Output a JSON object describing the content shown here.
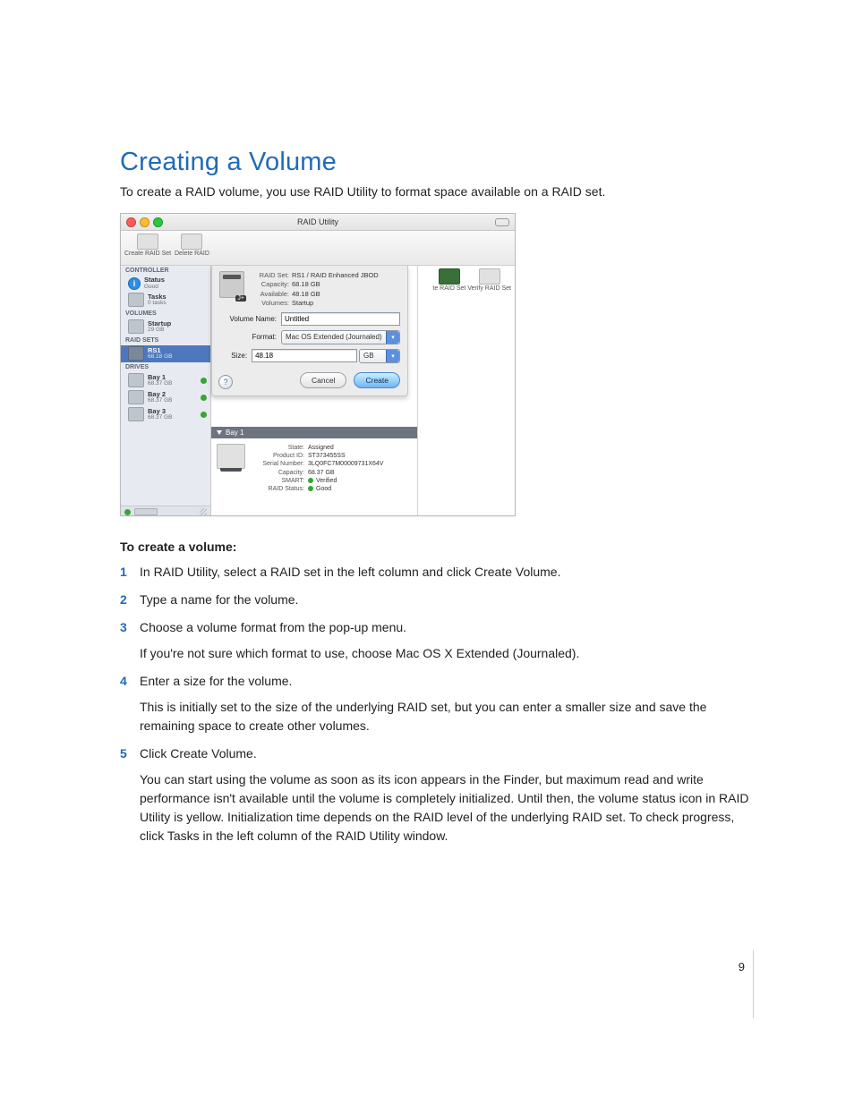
{
  "doc": {
    "heading": "Creating a Volume",
    "intro": "To create a RAID volume, you use RAID Utility to format space available on a RAID set.",
    "subheading": "To create a volume:",
    "steps": {
      "s1": "In RAID Utility, select a RAID set in the left column and click Create Volume.",
      "s2": "Type a name for the volume.",
      "s3": "Choose a volume format from the pop-up menu.",
      "s3_note": "If you're not sure which format to use, choose Mac OS X Extended (Journaled).",
      "s4": "Enter a size for the volume.",
      "s4_note": "This is initially set to the size of the underlying RAID set, but you can enter a smaller size and save the remaining space to create other volumes.",
      "s5": "Click Create Volume.",
      "s5_note": "You can start using the volume as soon as its icon appears in the Finder, but maximum read and write performance isn't available until the volume is completely initialized. Until then, the volume status icon in RAID Utility is yellow. Initialization time depends on the RAID level of the underlying RAID set. To check progress, click Tasks in the left column of the RAID Utility window."
    },
    "page_number": "9"
  },
  "app": {
    "window_title": "RAID Utility",
    "toolbar": {
      "create_raid": "Create RAID Set",
      "delete_raid": "Delete RAID",
      "right_a": "te RAID Set",
      "right_b": "Verify RAID Set"
    },
    "sidebar": {
      "controller": "CONTROLLER",
      "status": {
        "label": "Status",
        "sub": "Good"
      },
      "tasks": {
        "label": "Tasks",
        "sub": "0 tasks"
      },
      "volumes": "VOLUMES",
      "startup": {
        "label": "Startup",
        "sub": "29 GB"
      },
      "raidsets": "RAID SETS",
      "rs1": {
        "label": "RS1",
        "sub": "68.18 GB"
      },
      "drives": "DRIVES",
      "bay1": {
        "label": "Bay 1",
        "sub": "68.37 GB"
      },
      "bay2": {
        "label": "Bay 2",
        "sub": "68.37 GB"
      },
      "bay3": {
        "label": "Bay 3",
        "sub": "68.37 GB"
      }
    },
    "sheet": {
      "raid_set_lab": "RAID Set:",
      "raid_set_val": "RS1 / RAID Enhanced JBOD",
      "capacity_lab": "Capacity:",
      "capacity_val": "68.18 GB",
      "available_lab": "Available:",
      "available_val": "48.18 GB",
      "volumes_lab": "Volumes:",
      "volumes_val": "Startup",
      "name_label": "Volume Name:",
      "name_value": "Untitled",
      "format_label": "Format:",
      "format_value": "Mac OS Extended (Journaled)",
      "size_label": "Size:",
      "size_value": "48.18",
      "size_unit": "GB",
      "cancel": "Cancel",
      "create": "Create",
      "help": "?",
      "jp": "J+"
    },
    "bay_panel": {
      "header": "Bay 1",
      "state_l": "State:",
      "state_v": "Assigned",
      "product_l": "Product ID:",
      "product_v": "ST373455SS",
      "serial_l": "Serial Number:",
      "serial_v": "3LQ0FC7M00009731X64V",
      "cap_l": "Capacity:",
      "cap_v": "68.37 GB",
      "smart_l": "SMART:",
      "smart_v": "Verified",
      "raid_l": "RAID Status:",
      "raid_v": "Good"
    }
  }
}
